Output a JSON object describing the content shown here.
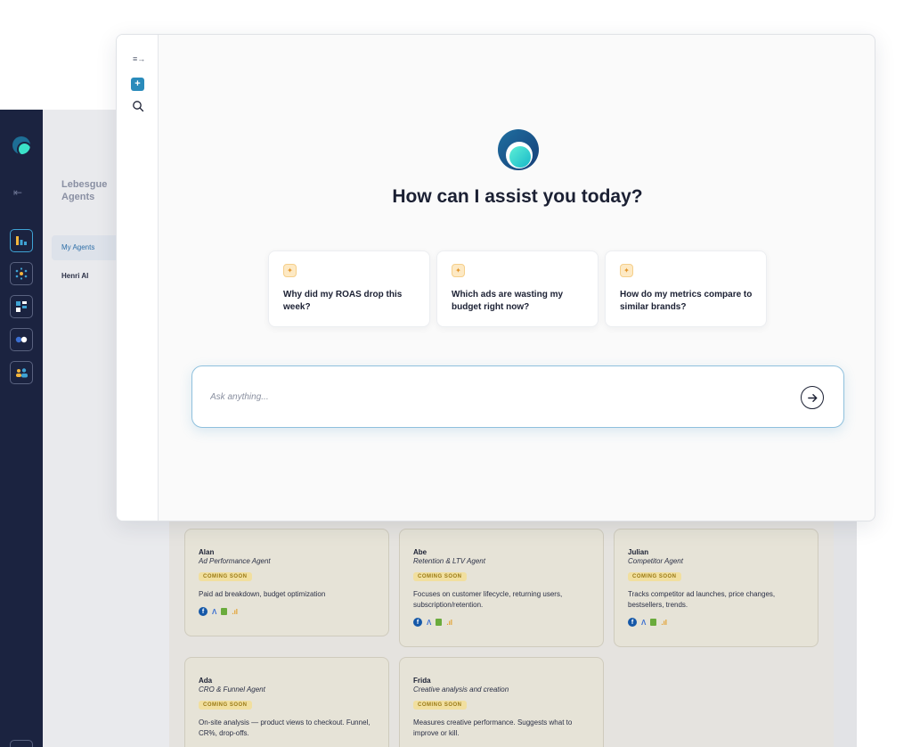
{
  "background_app": {
    "brand": "Lebesgue Agents",
    "nav": [
      {
        "label": "My Agents",
        "active": true
      },
      {
        "label": "Henri AI",
        "active": false
      }
    ],
    "agents": [
      {
        "name": "Alan",
        "role": "Ad Performance Agent",
        "badge": "COMING SOON",
        "description": "Paid ad breakdown, budget optimization"
      },
      {
        "name": "Abe",
        "role": "Retention & LTV Agent",
        "badge": "COMING SOON",
        "description": "Focuses on customer lifecycle, returning users, subscription/retention."
      },
      {
        "name": "Julian",
        "role": "Competitor Agent",
        "badge": "COMING SOON",
        "description": "Tracks competitor ad launches, price changes, bestsellers, trends."
      },
      {
        "name": "Ada",
        "role": "CRO & Funnel Agent",
        "badge": "COMING SOON",
        "description": "On-site analysis — product views to checkout. Funnel, CR%, drop-offs."
      },
      {
        "name": "Frida",
        "role": "Creative analysis and creation",
        "badge": "COMING SOON",
        "description": "Measures creative performance. Suggests what to improve or kill."
      }
    ],
    "integration_icons": [
      "facebook-icon",
      "google-ads-icon",
      "shopify-icon",
      "analytics-icon"
    ]
  },
  "chat": {
    "title": "How can I assist you today?",
    "suggestions": [
      "Why did my ROAS drop this week?",
      "Which ads are wasting my budget right now?",
      "How do my metrics compare to similar brands?"
    ],
    "input": {
      "placeholder": "Ask anything...",
      "value": ""
    },
    "new_chat_symbol": "+",
    "suggestion_symbol": "✦"
  },
  "colors": {
    "rail": "#1b2340",
    "accent": "#2a8bbb",
    "badge": "#f1df9f",
    "card": "#e6e3d7"
  }
}
